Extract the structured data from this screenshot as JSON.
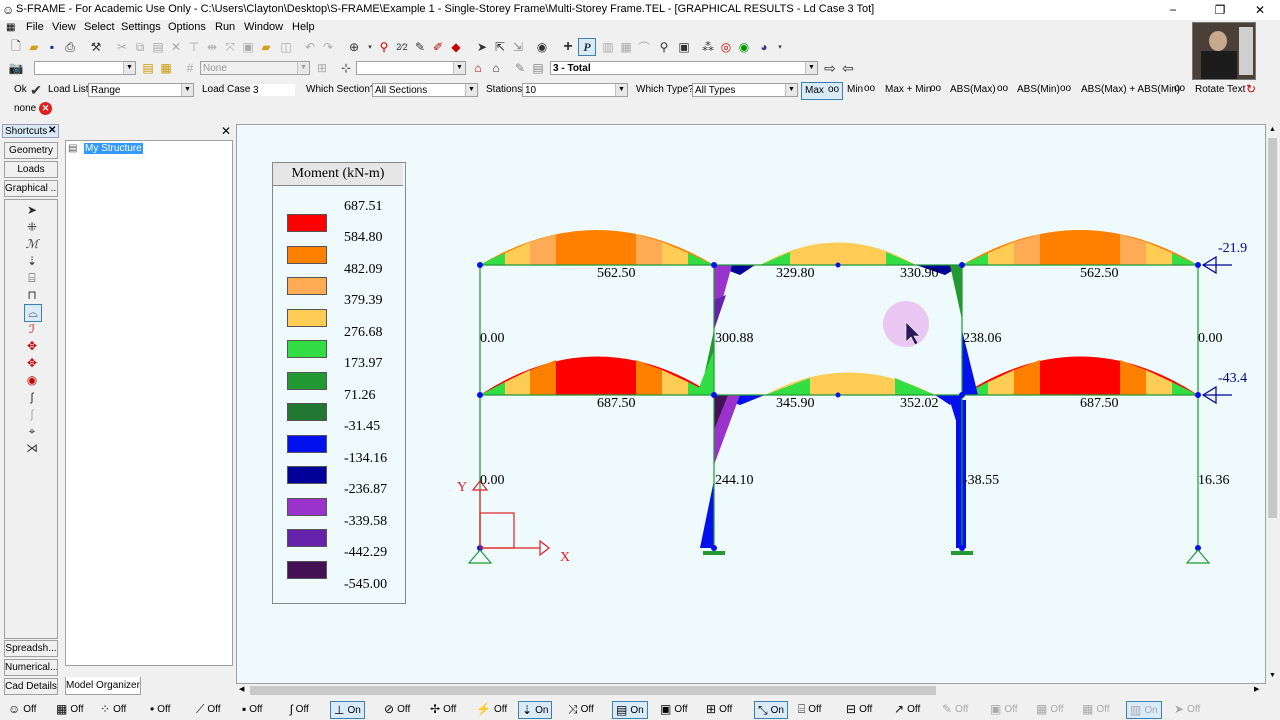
{
  "window": {
    "title": "S-FRAME - For Academic Use Only - C:\\Users\\Clayton\\Desktop\\S-FRAME\\Example 1 - Single-Storey Frame\\Multi-Storey Frame.TEL - [GRAPHICAL RESULTS - Ld Case 3 Tot]",
    "minimize": "−",
    "restore": "❐",
    "close": "✕"
  },
  "menu": [
    "File",
    "View",
    "Select",
    "Settings",
    "Options",
    "Run",
    "Window",
    "Help"
  ],
  "toolbar2": {
    "none_label": "None",
    "loadcase_combo": "3 - Total"
  },
  "results_bar": {
    "ok_label": "Ok",
    "load_list_label": "Load List",
    "load_list_value": "Range",
    "load_case_label": "Load Case",
    "load_case_value": "3",
    "which_section_label": "Which Section?",
    "which_section_value": "All Sections",
    "stations_label": "Stations",
    "stations_value": "10",
    "which_type_label": "Which Type?",
    "which_type_value": "All Types",
    "max_label": "Max",
    "min_label": "Min",
    "maxmin_label": "Max + Min",
    "absmax_label": "ABS(Max)",
    "absmin_label": "ABS(Min)",
    "absboth_label": "ABS(Max) + ABS(Min)",
    "rotate_text_label": "Rotate Text",
    "none_label": "none"
  },
  "shortcuts": {
    "title": "Shortcuts",
    "top_buttons": [
      "Geometry",
      "Loads",
      "Graphical ..."
    ],
    "bottom_buttons": [
      "Spreadsh...",
      "Numerical...",
      "Cad Details"
    ]
  },
  "organizer": {
    "root_item": "My Structure",
    "tab_label": "Model Organizer"
  },
  "legend": {
    "title": "Moment (kN-m)",
    "top_value": "687.51",
    "entries": [
      {
        "color": "#ff0000",
        "value": "584.80"
      },
      {
        "color": "#ff8000",
        "value": "482.09"
      },
      {
        "color": "#ffaa55",
        "value": "379.39"
      },
      {
        "color": "#ffcc55",
        "value": "276.68"
      },
      {
        "color": "#33dd44",
        "value": "173.97"
      },
      {
        "color": "#229933",
        "value": "71.26"
      },
      {
        "color": "#227733",
        "value": "-31.45"
      },
      {
        "color": "#0011ee",
        "value": "-134.16"
      },
      {
        "color": "#000099",
        "value": "-236.87"
      },
      {
        "color": "#9933cc",
        "value": "-339.58"
      },
      {
        "color": "#6622aa",
        "value": "-442.29"
      },
      {
        "color": "#441155",
        "value": "-545.00"
      }
    ]
  },
  "diagram_values": {
    "beam_top_left": "562.50",
    "beam_top_mid_left": "329.80",
    "beam_top_mid_right": "330.90",
    "beam_top_right": "562.50",
    "beam_bot_left": "687.50",
    "beam_bot_mid_left": "345.90",
    "beam_bot_mid_right": "352.02",
    "beam_bot_right": "687.50",
    "col1_upper": "0.00",
    "col2_upper": "300.88",
    "col3_upper": "238.06",
    "col4_upper": "0.00",
    "col1_lower": "0.00",
    "col2_lower": "244.10",
    "col3_lower": "-38.55",
    "col4_lower": "16.36",
    "load_top": "-21.9",
    "load_bot": "-43.4",
    "axis_x": "X",
    "axis_y": "Y"
  },
  "statusbar": [
    {
      "icon": "smile",
      "label": "Off",
      "state": "off"
    },
    {
      "icon": "grid",
      "label": "Off",
      "state": "off"
    },
    {
      "icon": "node",
      "label": "Off",
      "state": "off"
    },
    {
      "icon": "dot",
      "label": "Off",
      "state": "off"
    },
    {
      "icon": "member",
      "label": "Off",
      "state": "off"
    },
    {
      "icon": "plate",
      "label": "Off",
      "state": "off"
    },
    {
      "icon": "spring",
      "label": "Off",
      "state": "off"
    },
    {
      "icon": "support",
      "label": "On",
      "state": "on"
    },
    {
      "icon": "release",
      "label": "Off",
      "state": "off"
    },
    {
      "icon": "load",
      "label": "Off",
      "state": "off"
    },
    {
      "icon": "dload",
      "label": "Off",
      "state": "off"
    },
    {
      "icon": "zdown",
      "label": "On",
      "state": "on"
    },
    {
      "icon": "local",
      "label": "Off",
      "state": "off"
    },
    {
      "icon": "colors",
      "label": "On",
      "state": "on"
    },
    {
      "icon": "sections",
      "label": "Off",
      "state": "off"
    },
    {
      "icon": "rigid",
      "label": "Off",
      "state": "off"
    },
    {
      "icon": "scale",
      "label": "On",
      "state": "on"
    },
    {
      "icon": "frame",
      "label": "Off",
      "state": "off"
    },
    {
      "icon": "frame2",
      "label": "Off",
      "state": "off"
    },
    {
      "icon": "arrow",
      "label": "Off",
      "state": "off"
    },
    {
      "icon": "pen",
      "label": "Off",
      "state": "dim"
    },
    {
      "icon": "box",
      "label": "Off",
      "state": "dim"
    },
    {
      "icon": "box2",
      "label": "Off",
      "state": "dim"
    },
    {
      "icon": "box3",
      "label": "Off",
      "state": "dim"
    },
    {
      "icon": "box4",
      "label": "On",
      "state": "dimon"
    },
    {
      "icon": "cursor",
      "label": "Off",
      "state": "dim"
    }
  ]
}
